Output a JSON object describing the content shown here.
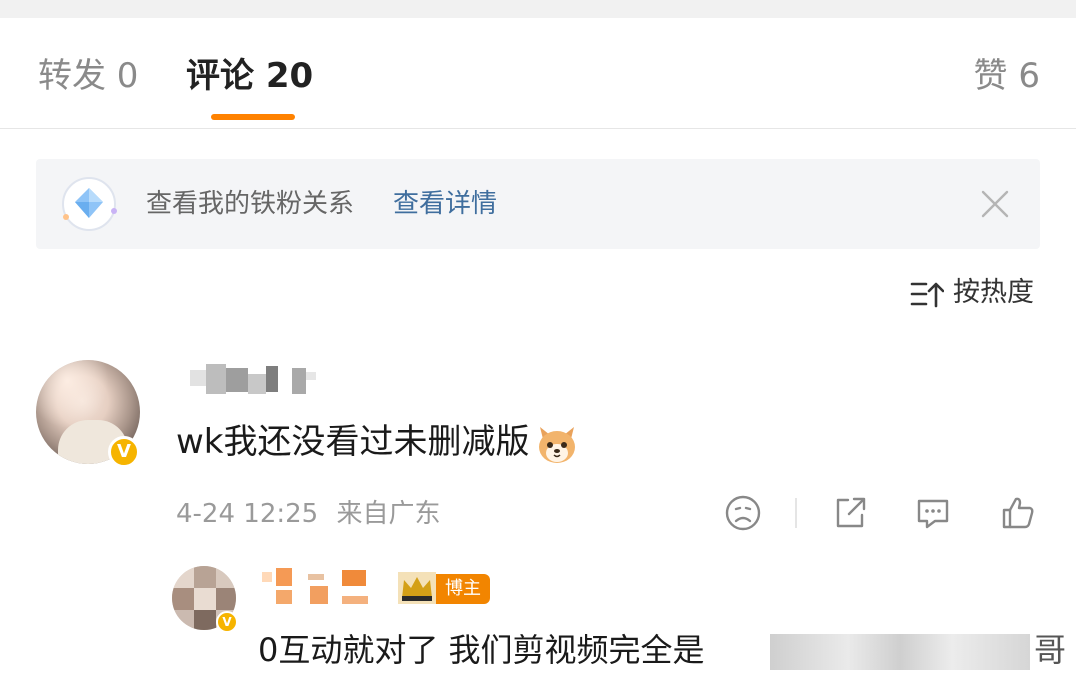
{
  "tabs": {
    "repost": "转发 0",
    "comment": "评论 20",
    "like": "赞 6"
  },
  "banner": {
    "text": "查看我的铁粉关系",
    "link": "查看详情"
  },
  "sort": {
    "label": "按热度",
    "icon": "sort-icon"
  },
  "comment": {
    "text": "wk我还没看过未删减版",
    "emoji": "dog-emoji",
    "time": "4-24 12:25",
    "location": "来自广东",
    "verified": "V"
  },
  "reply": {
    "badge": "博主",
    "text": "0互动就对了 我们剪视频完全是",
    "tail": "哥",
    "verified": "V"
  },
  "colors": {
    "accent": "#ff8200",
    "link": "#3f6e9e",
    "verified": "#f6b400",
    "meta_gray": "#9a9a9a"
  }
}
